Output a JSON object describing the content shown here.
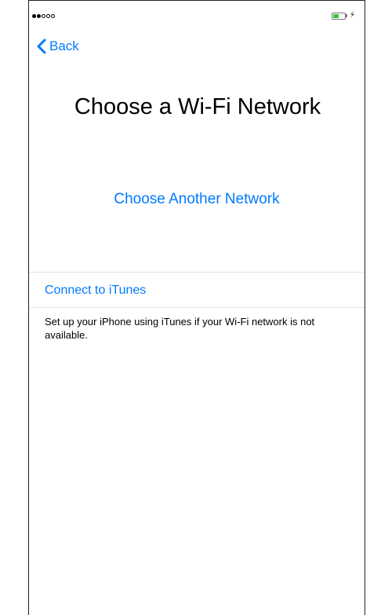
{
  "status_bar": {
    "signal": {
      "filled": 2,
      "total": 5
    },
    "battery": {
      "level": 0.45,
      "charging": true,
      "color": "#33c33f",
      "bolt_glyph": "⚡"
    }
  },
  "nav": {
    "back_label": "Back",
    "back_icon": "chevron-left-icon"
  },
  "screen": {
    "title": "Choose a Wi-Fi Network",
    "choose_another_label": "Choose Another Network",
    "connect_itunes_label": "Connect to iTunes",
    "footer_note": "Set up your iPhone using iTunes if your Wi-Fi network is not available."
  },
  "colors": {
    "accent": "#007aff",
    "divider": "#e2e2e4"
  }
}
